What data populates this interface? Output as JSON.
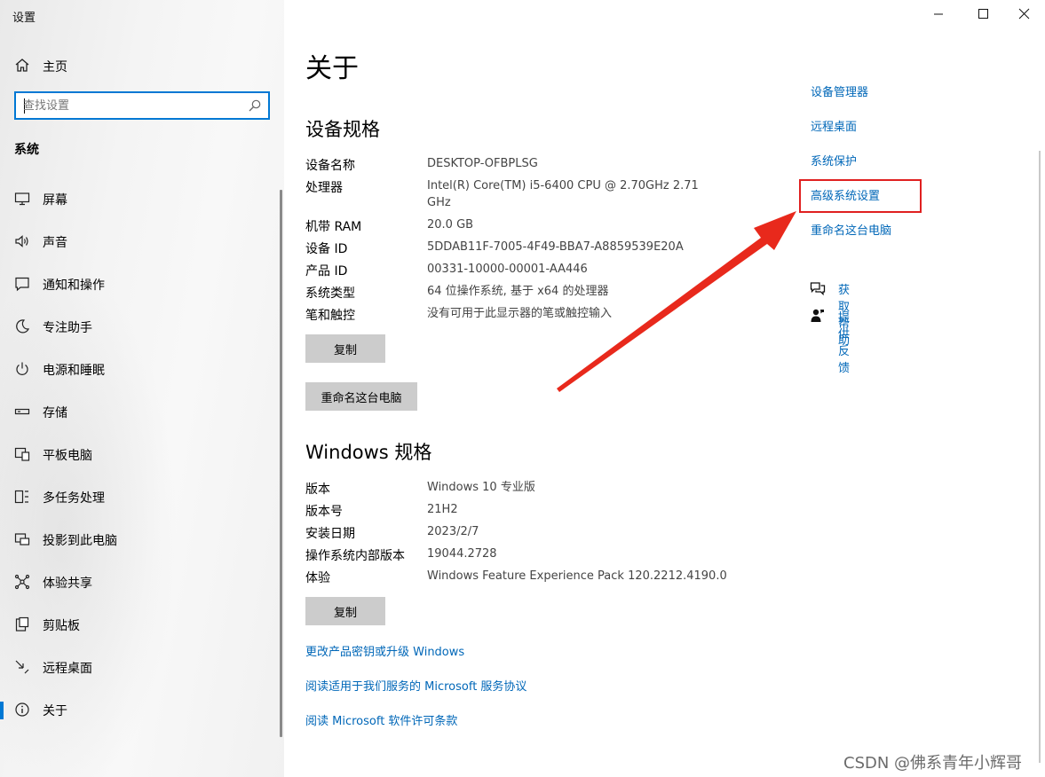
{
  "window": {
    "title": "设置"
  },
  "sidebar": {
    "home": "主页",
    "search_placeholder": "查找设置",
    "section": "系统",
    "items": [
      {
        "label": "屏幕",
        "icon": "monitor-icon"
      },
      {
        "label": "声音",
        "icon": "speaker-icon"
      },
      {
        "label": "通知和操作",
        "icon": "notification-icon"
      },
      {
        "label": "专注助手",
        "icon": "moon-icon"
      },
      {
        "label": "电源和睡眠",
        "icon": "power-icon"
      },
      {
        "label": "存储",
        "icon": "storage-icon"
      },
      {
        "label": "平板电脑",
        "icon": "tablet-icon"
      },
      {
        "label": "多任务处理",
        "icon": "multitask-icon"
      },
      {
        "label": "投影到此电脑",
        "icon": "project-icon"
      },
      {
        "label": "体验共享",
        "icon": "share-icon"
      },
      {
        "label": "剪贴板",
        "icon": "clipboard-icon"
      },
      {
        "label": "远程桌面",
        "icon": "remote-desktop-icon"
      },
      {
        "label": "关于",
        "icon": "info-icon",
        "active": true
      }
    ]
  },
  "main": {
    "title": "关于",
    "device_specs": {
      "heading": "设备规格",
      "rows": [
        {
          "label": "设备名称",
          "value": "DESKTOP-OFBPLSG"
        },
        {
          "label": "处理器",
          "value": "Intel(R) Core(TM) i5-6400 CPU @ 2.70GHz   2.71 GHz"
        },
        {
          "label": "机带 RAM",
          "value": "20.0 GB"
        },
        {
          "label": "设备 ID",
          "value": "5DDAB11F-7005-4F49-BBA7-A8859539E20A"
        },
        {
          "label": "产品 ID",
          "value": "00331-10000-00001-AA446"
        },
        {
          "label": "系统类型",
          "value": "64 位操作系统, 基于 x64 的处理器"
        },
        {
          "label": "笔和触控",
          "value": "没有可用于此显示器的笔或触控输入"
        }
      ],
      "copy_button": "复制",
      "rename_button": "重命名这台电脑"
    },
    "windows_specs": {
      "heading": "Windows 规格",
      "rows": [
        {
          "label": "版本",
          "value": "Windows 10 专业版"
        },
        {
          "label": "版本号",
          "value": "21H2"
        },
        {
          "label": "安装日期",
          "value": "2023/2/7"
        },
        {
          "label": "操作系统内部版本",
          "value": "19044.2728"
        },
        {
          "label": "体验",
          "value": "Windows Feature Experience Pack 120.2212.4190.0"
        }
      ],
      "copy_button": "复制"
    },
    "links": [
      "更改产品密钥或升级 Windows",
      "阅读适用于我们服务的 Microsoft 服务协议",
      "阅读 Microsoft 软件许可条款"
    ]
  },
  "related": {
    "links": [
      "设备管理器",
      "远程桌面",
      "系统保护",
      "高级系统设置",
      "重命名这台电脑"
    ],
    "get_help": "获取帮助",
    "feedback": "提供反馈"
  },
  "watermark": "CSDN @佛系青年小辉哥",
  "colors": {
    "accent": "#0078d4",
    "link": "#0067b8",
    "highlight": "#e02020",
    "button": "#cccccc"
  }
}
